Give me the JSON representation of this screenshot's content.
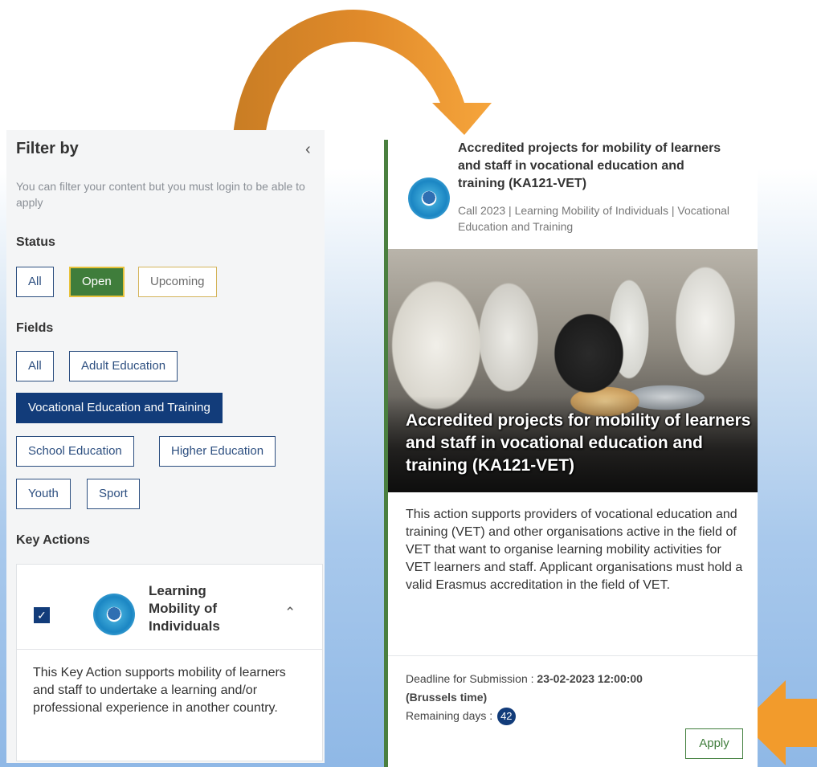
{
  "filter": {
    "title": "Filter by",
    "collapse_icon": "chevron-left-icon",
    "note": "You can filter your content but you must login to be able to apply",
    "status": {
      "label": "Status",
      "options": [
        "All",
        "Open",
        "Upcoming"
      ],
      "selected": "Open"
    },
    "fields": {
      "label": "Fields",
      "options": [
        "All",
        "Adult Education",
        "Vocational Education and Training",
        "School Education",
        "Higher Education",
        "Youth",
        "Sport"
      ],
      "selected": "Vocational Education and Training"
    },
    "key_actions": {
      "label": "Key Actions",
      "item": {
        "checked": true,
        "icon": "globe-icon",
        "title": "Learning Mobility of Individuals",
        "expand_icon": "chevron-up-icon",
        "description": "This Key Action supports mobility of learners and staff to undertake a learning and/or professional experience in another country."
      }
    }
  },
  "call": {
    "icon": "globe-icon",
    "title": "Accredited projects for mobility of learners and staff in vocational education and training (KA121-VET)",
    "meta": "Call 2023 | Learning Mobility of Individuals | Vocational Education and Training",
    "hero_text": "Accredited projects for mobility of learners and staff in vocational education and training (KA121-VET)",
    "description": "This action supports providers of vocational education and training (VET) and other organisations active in the field of VET that want to organise learning mobility activities for VET learners and staff. Applicant organisations must hold a valid Erasmus accreditation in the field of VET.",
    "deadline_label": "Deadline for Submission : ",
    "deadline_value": "23-02-2023 12:00:00",
    "deadline_zone": "(Brussels time)",
    "remaining_label": "Remaining days : ",
    "remaining_days": "42",
    "apply_label": "Apply"
  },
  "colors": {
    "arrow_orange": "#f29b2c",
    "card_accent": "#4a7f3f",
    "primary_blue": "#123c7a"
  }
}
